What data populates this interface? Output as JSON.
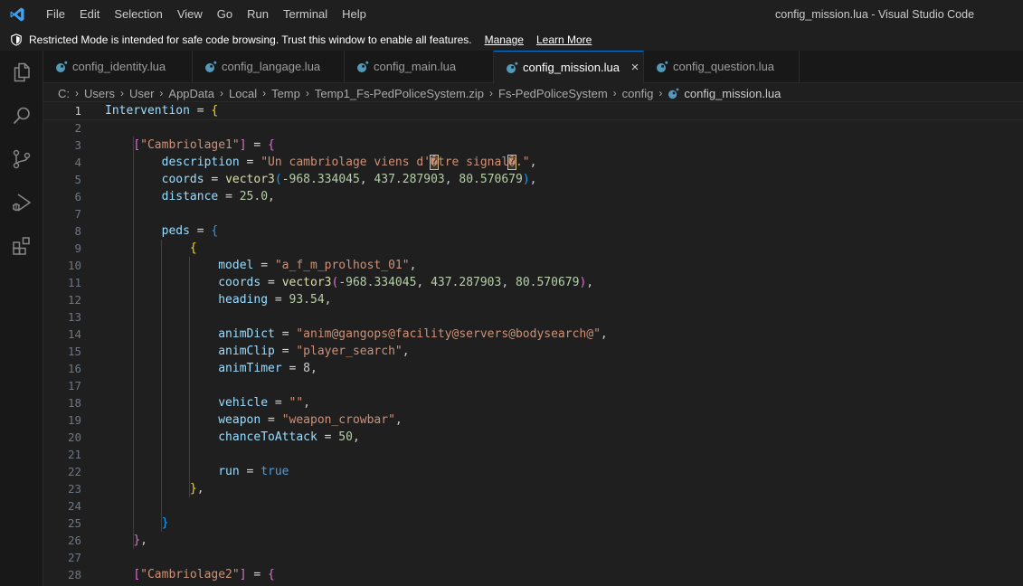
{
  "titlebar": {
    "menu": [
      "File",
      "Edit",
      "Selection",
      "View",
      "Go",
      "Run",
      "Terminal",
      "Help"
    ],
    "window_title": "config_mission.lua - Visual Studio Code"
  },
  "banner": {
    "message": "Restricted Mode is intended for safe code browsing. Trust this window to enable all features.",
    "manage": "Manage",
    "learn_more": "Learn More"
  },
  "tabs": [
    {
      "label": "config_identity.lua",
      "active": false
    },
    {
      "label": "config_langage.lua",
      "active": false
    },
    {
      "label": "config_main.lua",
      "active": false
    },
    {
      "label": "config_mission.lua",
      "active": true
    },
    {
      "label": "config_question.lua",
      "active": false
    }
  ],
  "tab_close_glyph": "×",
  "breadcrumb": [
    "C:",
    "Users",
    "User",
    "AppData",
    "Local",
    "Temp",
    "Temp1_Fs-PedPoliceSystem.zip",
    "Fs-PedPoliceSystem",
    "config",
    "config_mission.lua"
  ],
  "colors": {
    "accent": "#0078d4",
    "lua_icon": "#519aba",
    "vscode_logo": "#3ea3f5"
  },
  "icons": {
    "activity": [
      "explorer-icon",
      "search-icon",
      "source-control-icon",
      "run-debug-icon",
      "extensions-icon"
    ]
  },
  "editor": {
    "current_line": 1,
    "lines": [
      {
        "n": "1",
        "text": "Intervention = {"
      },
      {
        "n": "2",
        "text": ""
      },
      {
        "n": "3",
        "text": "    [\"Cambriolage1\"] = {"
      },
      {
        "n": "4",
        "text": "        description = \"Un cambriolage viens d'�tre signal�.\","
      },
      {
        "n": "5",
        "text": "        coords = vector3(-968.334045, 437.287903, 80.570679),"
      },
      {
        "n": "6",
        "text": "        distance = 25.0,"
      },
      {
        "n": "7",
        "text": ""
      },
      {
        "n": "8",
        "text": "        peds = {"
      },
      {
        "n": "9",
        "text": "            {"
      },
      {
        "n": "10",
        "text": "                model = \"a_f_m_prolhost_01\","
      },
      {
        "n": "11",
        "text": "                coords = vector3(-968.334045, 437.287903, 80.570679),"
      },
      {
        "n": "12",
        "text": "                heading = 93.54,"
      },
      {
        "n": "13",
        "text": ""
      },
      {
        "n": "14",
        "text": "                animDict = \"anim@gangops@facility@servers@bodysearch@\","
      },
      {
        "n": "15",
        "text": "                animClip = \"player_search\","
      },
      {
        "n": "16",
        "text": "                animTimer = 8,"
      },
      {
        "n": "17",
        "text": ""
      },
      {
        "n": "18",
        "text": "                vehicle = \"\","
      },
      {
        "n": "19",
        "text": "                weapon = \"weapon_crowbar\","
      },
      {
        "n": "20",
        "text": "                chanceToAttack = 50,"
      },
      {
        "n": "21",
        "text": ""
      },
      {
        "n": "22",
        "text": "                run = true"
      },
      {
        "n": "23",
        "text": "            },"
      },
      {
        "n": "24",
        "text": ""
      },
      {
        "n": "25",
        "text": "        }"
      },
      {
        "n": "26",
        "text": "    },"
      },
      {
        "n": "27",
        "text": ""
      },
      {
        "n": "28",
        "text": "    [\"Cambriolage2\"] = {"
      }
    ]
  }
}
